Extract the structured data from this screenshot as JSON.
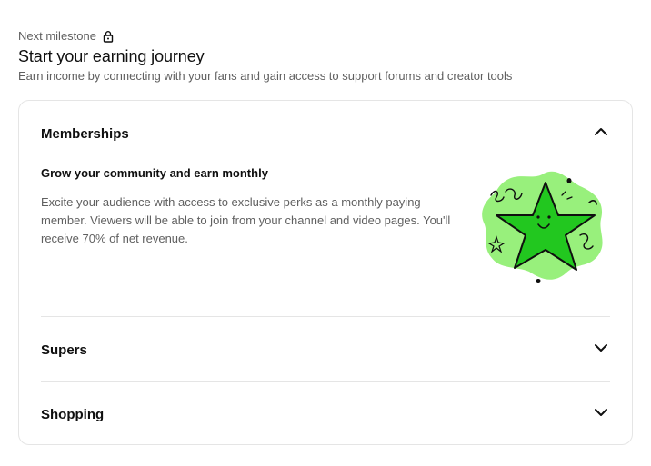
{
  "header": {
    "milestone_label": "Next milestone",
    "title": "Start your earning journey",
    "subtitle": "Earn income by connecting with your fans and gain access to support forums and creator tools"
  },
  "sections": {
    "memberships": {
      "title": "Memberships",
      "expanded": true,
      "heading": "Grow your community and earn monthly",
      "description": "Excite your audience with access to exclusive perks as a monthly paying member. Viewers will be able to join from your channel and video pages. You'll receive 70% of net revenue."
    },
    "supers": {
      "title": "Supers",
      "expanded": false
    },
    "shopping": {
      "title": "Shopping",
      "expanded": false
    }
  },
  "colors": {
    "star_fill": "#22c71f",
    "star_glow": "#98f07c",
    "text_primary": "#0f0f0f",
    "text_secondary": "#606060",
    "border": "#e5e5e5"
  },
  "icons": {
    "milestone": "lock-icon",
    "expanded": "chevron-up-icon",
    "collapsed": "chevron-down-icon"
  }
}
